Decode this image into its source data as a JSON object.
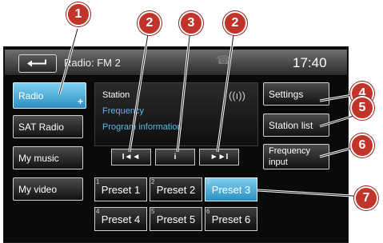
{
  "header": {
    "title": "Radio: FM 2",
    "time": "17:40",
    "back_icon": "back-arrow-icon",
    "phone_icon": "phone-icon"
  },
  "sources": [
    {
      "label": "Radio",
      "active": true,
      "badge": "+"
    },
    {
      "label": "SAT Radio"
    },
    {
      "label": "My music"
    },
    {
      "label": "My video"
    }
  ],
  "info": {
    "station": "Station",
    "frequency": "Frequency",
    "program": "Program information",
    "signal_icon": "signal-icon"
  },
  "controls": {
    "prev": "I◄◄",
    "info": "i",
    "next": "►►I"
  },
  "right_menu": {
    "settings": "Settings",
    "station_list": "Station list",
    "frequency_input_line1": "Frequency",
    "frequency_input_line2": "input"
  },
  "presets": [
    {
      "num": "1",
      "label": "Preset 1"
    },
    {
      "num": "2",
      "label": "Preset 2"
    },
    {
      "num": "3",
      "label": "Preset 3",
      "selected": true
    },
    {
      "num": "4",
      "label": "Preset 4"
    },
    {
      "num": "5",
      "label": "Preset 5"
    },
    {
      "num": "6",
      "label": "Preset 6"
    }
  ],
  "callouts": [
    "1",
    "2",
    "3",
    "2",
    "4",
    "5",
    "6",
    "7"
  ],
  "colors": {
    "active_blue": "#2c8fc2",
    "callout_red": "#c0342a",
    "frequency_text": "#5ab8e8"
  }
}
